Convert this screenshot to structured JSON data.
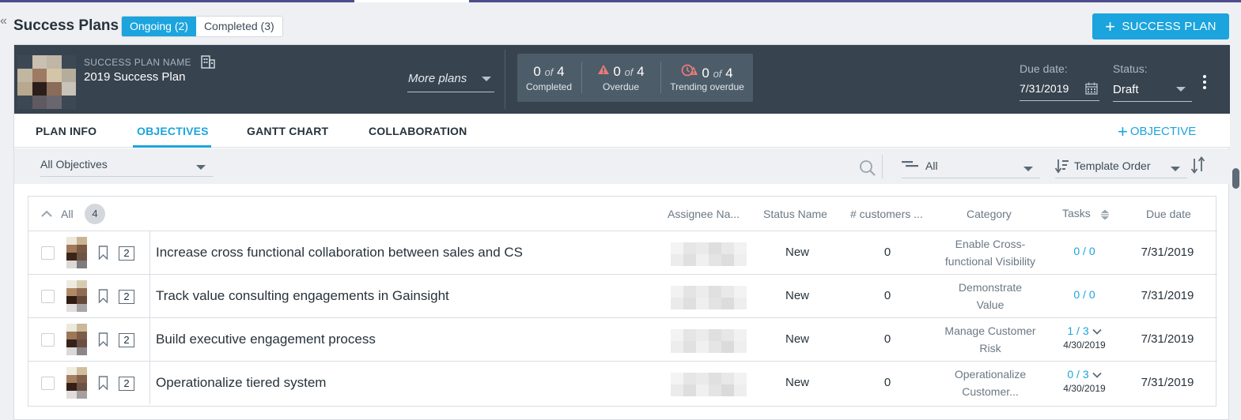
{
  "page": {
    "title": "Success Plans",
    "collapse_glyph": "«",
    "segments": {
      "ongoing": "Ongoing (2)",
      "completed": "Completed (3)"
    },
    "add_plan_label": "SUCCESS PLAN",
    "add_plan_plus": "+"
  },
  "colors": {
    "accent": "#1ba4dd",
    "header_bg": "#37434f",
    "stats_bg": "#4d5c69",
    "warning": "#e77a7a"
  },
  "plan": {
    "name_label": "SUCCESS PLAN NAME",
    "name": "2019 Success Plan",
    "more_plans": "More plans",
    "stats": {
      "completed": {
        "count": "0",
        "of": "of",
        "total": "4",
        "label": "Completed"
      },
      "overdue": {
        "count": "0",
        "of": "of",
        "total": "4",
        "label": "Overdue"
      },
      "trending": {
        "count": "0",
        "of": "of",
        "total": "4",
        "label": "Trending overdue"
      }
    },
    "due_label": "Due date:",
    "due_value": "7/31/2019",
    "status_label": "Status:",
    "status_value": "Draft"
  },
  "tabs": [
    {
      "label": "PLAN INFO",
      "active": false
    },
    {
      "label": "OBJECTIVES",
      "active": true
    },
    {
      "label": "GANTT CHART",
      "active": false
    },
    {
      "label": "COLLABORATION",
      "active": false
    }
  ],
  "add_objective": {
    "plus": "+",
    "label": "OBJECTIVE"
  },
  "toolbar": {
    "objectives_filter": "All Objectives",
    "status_filter": "All",
    "sort_by": "Template Order"
  },
  "grid": {
    "group_label": "All",
    "group_count": "4",
    "columns": {
      "assignee": "Assignee Na...",
      "status": "Status Name",
      "customers": "# customers ...",
      "category": "Category",
      "tasks": "Tasks",
      "due": "Due date"
    },
    "rows": [
      {
        "count": "2",
        "name": "Increase cross functional collaboration between sales and CS",
        "status": "New",
        "customers": "0",
        "category": [
          "Enable Cross-",
          "functional Visibility"
        ],
        "tasks": "0 / 0",
        "tasks_date": "",
        "due": "7/31/2019"
      },
      {
        "count": "2",
        "name": "Track value consulting engagements in Gainsight",
        "status": "New",
        "customers": "0",
        "category": [
          "Demonstrate",
          "Value"
        ],
        "tasks": "0 / 0",
        "tasks_date": "",
        "due": "7/31/2019"
      },
      {
        "count": "2",
        "name": "Build executive engagement process",
        "status": "New",
        "customers": "0",
        "category": [
          "Manage Customer",
          "Risk"
        ],
        "tasks": "1 / 3",
        "tasks_date": "4/30/2019",
        "due": "7/31/2019"
      },
      {
        "count": "2",
        "name": "Operationalize tiered system",
        "status": "New",
        "customers": "0",
        "category": [
          "Operationalize",
          "Customer..."
        ],
        "tasks": "0 / 3",
        "tasks_date": "4/30/2019",
        "due": "7/31/2019"
      }
    ]
  },
  "icons": [
    "chevron-collapse-icon",
    "plus-icon",
    "building-icon",
    "caret-down-icon",
    "warning-icon",
    "clock-warning-icon",
    "calendar-icon",
    "kebab-icon",
    "search-icon",
    "filter-icon",
    "sort-icon",
    "sort-order-icon",
    "chevron-up-icon",
    "bookmark-icon",
    "chevron-down-icon"
  ]
}
